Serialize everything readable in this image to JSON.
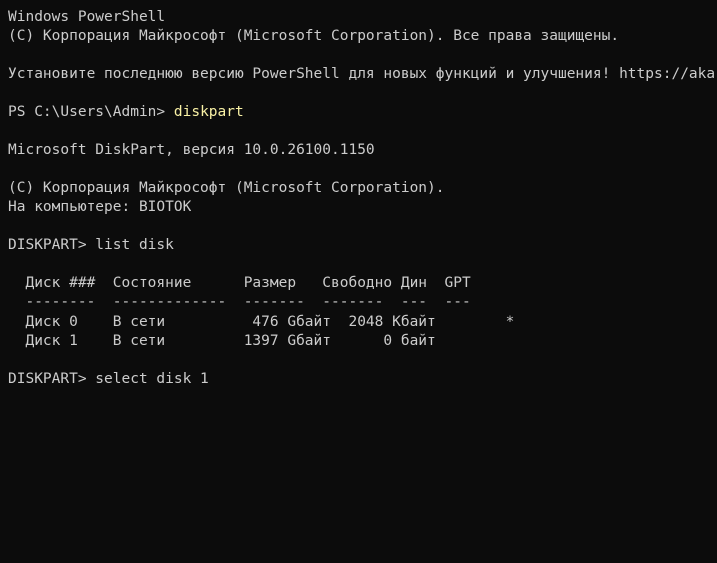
{
  "lines": {
    "l1": "Windows PowerShell",
    "l2": "(С) Корпорация Майкрософт (Microsoft Corporation). Все права защищены.",
    "l3": "Установите последнюю версию PowerShell для новых функций и улучшения! https://aka.ms/PSWindows",
    "prompt1_prefix": "PS C:\\Users\\Admin> ",
    "prompt1_cmd": "diskpart",
    "l5": "Microsoft DiskPart, версия 10.0.26100.1150",
    "l6": "(С) Корпорация Майкрософт (Microsoft Corporation).",
    "l7": "На компьютере: BIOTOK",
    "prompt2": "DISKPART> list disk",
    "prompt3": "DISKPART> select disk 1"
  },
  "disk_table": {
    "header": "  Диск ###  Состояние      Размер   Свободно Дин  GPT",
    "separator": "  --------  -------------  -------  -------  ---  ---",
    "rows": [
      "  Диск 0    В сети          476 Gбайт  2048 Кбайт        *",
      "  Диск 1    В сети         1397 Gбайт      0 байт"
    ]
  }
}
